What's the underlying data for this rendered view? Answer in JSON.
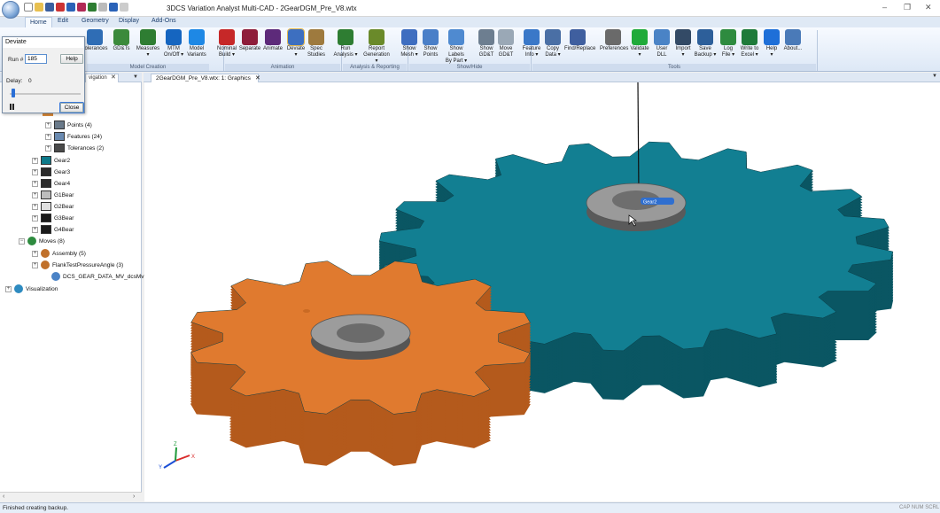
{
  "window": {
    "title": "3DCS Variation Analyst Multi-CAD - 2GearDGM_Pre_V8.wtx",
    "controls": [
      "–",
      "❐",
      "✕"
    ]
  },
  "ribbon_tabs": [
    "Home",
    "Edit",
    "Geometry",
    "Display",
    "Add-Ons"
  ],
  "ribbon": {
    "buttons": [
      {
        "id": "tolerances",
        "label": "Tolerances",
        "color": "#2f6db5"
      },
      {
        "id": "gdts",
        "label": "GD&Ts",
        "color": "#3b8a3b"
      },
      {
        "id": "measures",
        "label": "Measures\n▾",
        "color": "#2e7d32"
      },
      {
        "id": "mtm",
        "label": "MTM\nOn/Off ▾",
        "color": "#1565c0"
      },
      {
        "id": "model-variants",
        "label": "Model\nVariants",
        "color": "#1e88e5"
      },
      {
        "id": "nominal-build",
        "label": "Nominal\nBuild ▾",
        "color": "#c62828"
      },
      {
        "id": "separate",
        "label": "Separate",
        "color": "#8e1d3a"
      },
      {
        "id": "animate",
        "label": "Animate",
        "color": "#5d2a7a"
      },
      {
        "id": "deviate",
        "label": "Deviate\n▾",
        "color": "#3d6fc0"
      },
      {
        "id": "spec-studies",
        "label": "Spec\nStudies",
        "color": "#9e7a3e"
      },
      {
        "id": "run-analysis",
        "label": "Run\nAnalysis ▾",
        "color": "#2e7d32"
      },
      {
        "id": "report-generation",
        "label": "Report\nGeneration ▾",
        "color": "#6a8a2a"
      },
      {
        "id": "show-mesh",
        "label": "Show\nMesh ▾",
        "color": "#3f6ec0"
      },
      {
        "id": "show-points",
        "label": "Show\nPoints",
        "color": "#4a7fc8"
      },
      {
        "id": "show-labels",
        "label": "Show Labels\nBy Part ▾",
        "color": "#4f8ad0"
      },
      {
        "id": "show-gdt",
        "label": "Show\nGD&T",
        "color": "#6d7e90"
      },
      {
        "id": "move-gdt",
        "label": "Move\nGD&T",
        "color": "#9aa8b6"
      },
      {
        "id": "feature-info",
        "label": "Feature\nInfo ▾",
        "color": "#3a78c8"
      },
      {
        "id": "copy-data",
        "label": "Copy\nData ▾",
        "color": "#4a6fa5"
      },
      {
        "id": "find-replace",
        "label": "Find/Replace",
        "color": "#3f5f9f"
      },
      {
        "id": "preferences",
        "label": "Preferences",
        "color": "#6a6a6a"
      },
      {
        "id": "validate",
        "label": "Validate\n▾",
        "color": "#1faa3a"
      },
      {
        "id": "user-dll",
        "label": "User\nDLL",
        "color": "#4a83c6"
      },
      {
        "id": "import",
        "label": "Import\n▾",
        "color": "#334a66"
      },
      {
        "id": "save-backup",
        "label": "Save\nBackup ▾",
        "color": "#2d5f9a"
      },
      {
        "id": "log-file",
        "label": "Log\nFile ▾",
        "color": "#2e8b3f"
      },
      {
        "id": "write-to-excel",
        "label": "Write to\nExcel ▾",
        "color": "#1e7a3a"
      },
      {
        "id": "help",
        "label": "Help\n▾",
        "color": "#1e6fd8"
      },
      {
        "id": "about",
        "label": "About...",
        "color": "#4a7ab8"
      }
    ],
    "groups": [
      "Model Creation",
      "Animation",
      "Analysis & Reporting",
      "Show/Hide",
      "Tools"
    ]
  },
  "left_panel": {
    "tab_label": "vigation",
    "tree": [
      {
        "label": "Points (4)",
        "icon": "points-icon",
        "color": "#6a7a8a"
      },
      {
        "label": "Features (24)",
        "icon": "features-icon",
        "color": "#6a8ab0"
      },
      {
        "label": "Tolerances (2)",
        "icon": "tolerances-icon",
        "color": "#4a4a4a"
      },
      {
        "label": "Gear2",
        "icon": "part-icon",
        "color": "#0e7a8a"
      },
      {
        "label": "Gear3",
        "icon": "part-icon",
        "color": "#2b2b2b"
      },
      {
        "label": "Gear4",
        "icon": "part-icon",
        "color": "#2b2b2b"
      },
      {
        "label": "G1Bear",
        "icon": "part-icon",
        "color": "#bdbdbd"
      },
      {
        "label": "G2Bear",
        "icon": "part-icon",
        "color": "#e0e0e0"
      },
      {
        "label": "G3Bear",
        "icon": "part-icon",
        "color": "#1a1a1a"
      },
      {
        "label": "G4Bear",
        "icon": "part-icon",
        "color": "#1a1a1a"
      },
      {
        "label": "Moves (8)",
        "icon": "moves-icon",
        "color": "#2e8b3f"
      },
      {
        "label": "Assembly (5)",
        "icon": "assembly-icon",
        "color": "#c0702a"
      },
      {
        "label": "FlankTestPressureAngle (3)",
        "icon": "assembly-icon",
        "color": "#c0702a"
      },
      {
        "label": "DCS_GEAR_DATA_MV_dcsMvDo",
        "icon": "gear-data-icon",
        "color": "#4a83c6"
      },
      {
        "label": "Visualization",
        "icon": "globe-icon",
        "color": "#2e8bc0"
      }
    ]
  },
  "dialog": {
    "title": "Deviate",
    "run_label": "Run #",
    "run_value": "185",
    "help_label": "Help",
    "delay_label": "Delay:",
    "delay_value": "0",
    "close_label": "Close",
    "slider_fraction": 0.02
  },
  "document": {
    "tab_label": "2GearDGM_Pre_V8.wtx: 1: Graphics",
    "hover_label": "Gear2"
  },
  "axes": {
    "x": "X",
    "y": "Y",
    "z": "Z"
  },
  "colors": {
    "teal_gear": "#127f92",
    "orange_gear": "#e07a2f",
    "hub": "#8a8a8a"
  },
  "status": {
    "text": "Finished creating backup.",
    "keys": "CAP  NUM  SCRL"
  }
}
